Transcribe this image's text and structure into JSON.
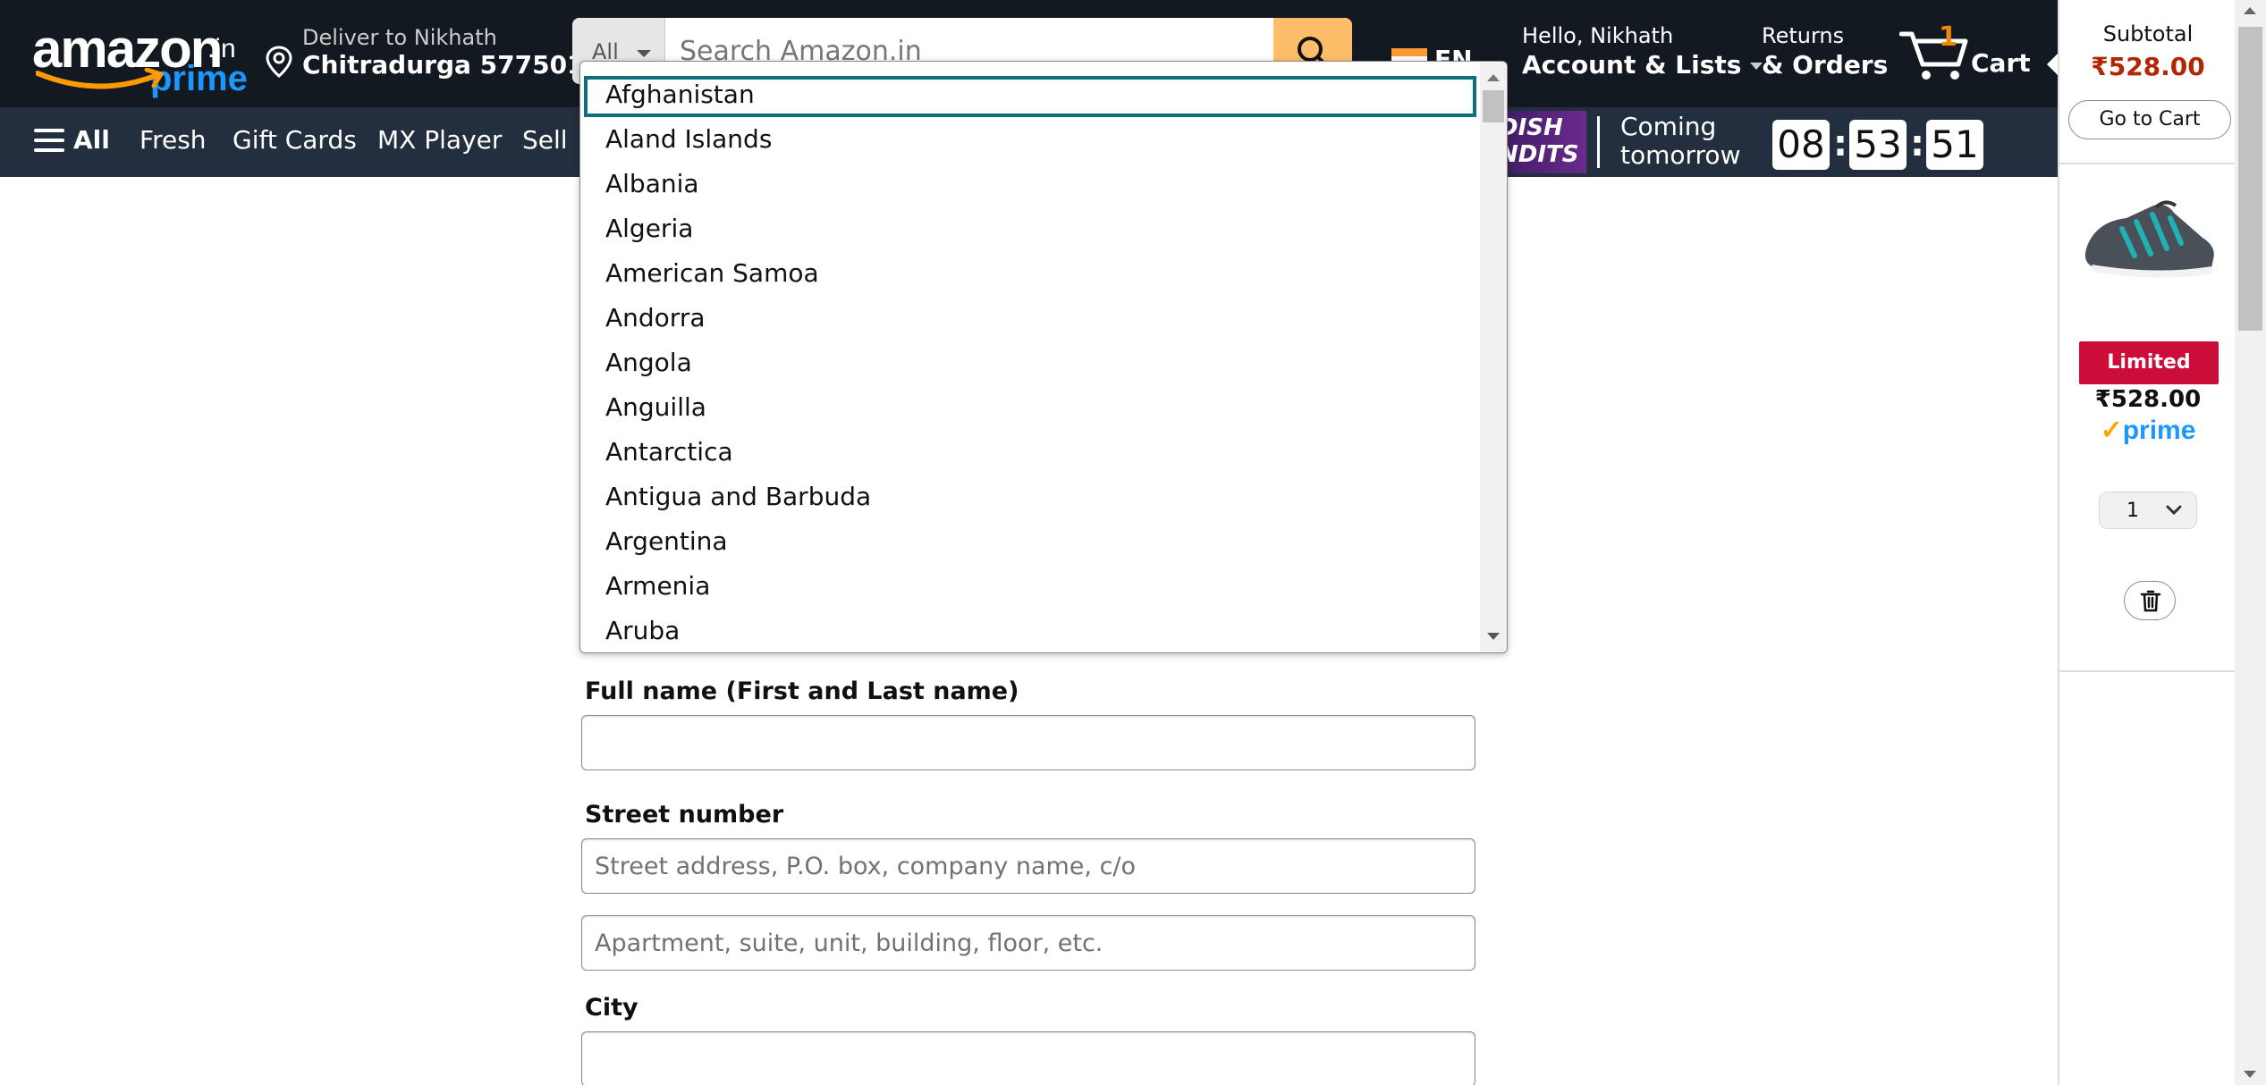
{
  "header": {
    "logo": {
      "word": "amazon",
      "tld": ".in",
      "prime": "prime"
    },
    "deliver": {
      "line1": "Deliver to Nikhath",
      "line2": "Chitradurga 577501"
    },
    "search": {
      "category": "All",
      "placeholder": "Search Amazon.in"
    },
    "language": "EN",
    "account": {
      "line1": "Hello, Nikhath",
      "line2": "Account & Lists"
    },
    "orders": {
      "line1": "Returns",
      "line2": "& Orders"
    },
    "cart": {
      "count": "1",
      "label": "Cart"
    }
  },
  "nav": {
    "items": [
      "All",
      "Fresh",
      "Gift Cards",
      "MX Player",
      "Sell"
    ],
    "promo": {
      "tag": "DISH\nNDITS",
      "text_line1": "Coming",
      "text_line2": "tomorrow"
    },
    "timer": {
      "hours": "08",
      "minutes": "53",
      "seconds": "51"
    }
  },
  "cart_sidebar": {
    "subtotal_label": "Subtotal",
    "subtotal_value": "₹528.00",
    "go_to_cart": "Go to Cart",
    "badge": "Limited time",
    "item_price": "₹528.00",
    "prime_check": "✓",
    "prime_label": "prime",
    "quantity": "1"
  },
  "country_dropdown": {
    "selected": "Afghanistan",
    "options": [
      "Afghanistan",
      "Aland Islands",
      "Albania",
      "Algeria",
      "American Samoa",
      "Andorra",
      "Angola",
      "Anguilla",
      "Antarctica",
      "Antigua and Barbuda",
      "Argentina",
      "Armenia",
      "Aruba"
    ]
  },
  "form": {
    "full_name": {
      "label": "Full name (First and Last name)",
      "value": "",
      "placeholder": ""
    },
    "street": {
      "label": "Street number",
      "line1_placeholder": "Street address, P.O. box, company name, c/o",
      "line2_placeholder": "Apartment, suite, unit, building, floor, etc."
    },
    "city": {
      "label": "City",
      "value": ""
    }
  },
  "colors": {
    "header_bg": "#131921",
    "nav_bg": "#232f3e",
    "search_button": "#febd69",
    "price_red": "#b12704",
    "badge_red": "#cc0c39",
    "prime_blue": "#1a98ff",
    "selected_outline": "#0f6f80"
  }
}
